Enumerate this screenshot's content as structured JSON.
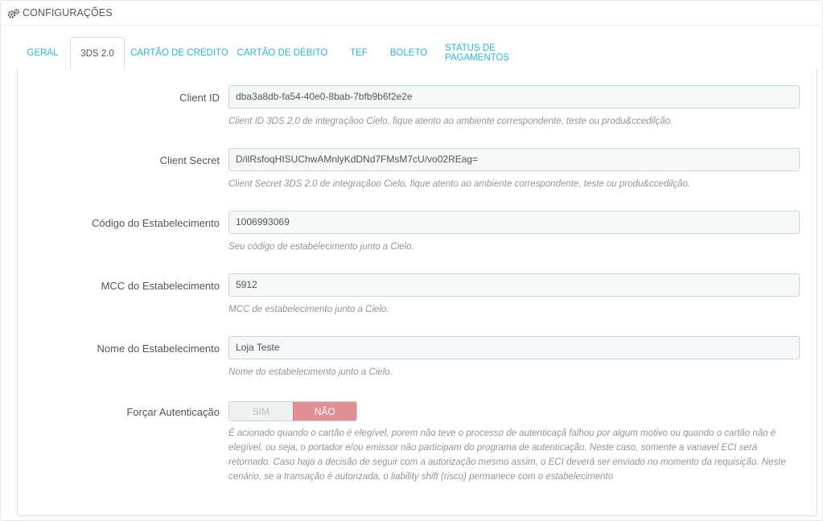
{
  "panel": {
    "title": "CONFIGURAÇÕES",
    "icon": "gears-icon"
  },
  "tabs": [
    {
      "label": "GERAL",
      "active": false
    },
    {
      "label": "3DS 2.0",
      "active": true
    },
    {
      "label": "CARTÃO DE CRÉDITO",
      "active": false
    },
    {
      "label": "CARTÃO DE DÉBITO",
      "active": false
    },
    {
      "label": "TEF",
      "active": false
    },
    {
      "label": "BOLETO",
      "active": false
    },
    {
      "label": "STATUS DE PAGAMENTOS",
      "active": false
    }
  ],
  "fields": {
    "client_id": {
      "label": "Client ID",
      "value": "dba3a8db-fa54-40e0-8bab-7bfb9b6f2e2e",
      "help": "Client ID 3DS 2.0 de integraçãoo Cielo, fique atento ao ambiente correspondente, teste ou produ&ccedilção."
    },
    "client_secret": {
      "label": "Client Secret",
      "value": "D/ilRsfoqHISUChwAMnlyKdDNd7FMsM7cU/vo02REag=",
      "help": "Client Secret 3DS 2.0 de integraçãoo Cielo, fique atento ao ambiente correspondente, teste ou produ&ccedilção."
    },
    "codigo": {
      "label": "Código do Estabelecimento",
      "value": "1006993069",
      "help": "Seu código de estabelecimento junto a Cielo."
    },
    "mcc": {
      "label": "MCC do Estabelecimento",
      "value": "5912",
      "help": "MCC de estabelecimento junto a Cielo."
    },
    "nome": {
      "label": "Nome do Estabelecimento",
      "value": "Loja Teste",
      "help": "Nome do estabelecimento junto a Cielo."
    },
    "forcar": {
      "label": "Forçar Autenticação",
      "option_yes": "SIM",
      "option_no": "NÃO",
      "selected": "NÃO",
      "help": "É acionado quando o cartão é elegível, porem não teve o processo de autenticaçã falhou por algum motivo ou quando o cartão não é elegível, ou seja, o portador e/ou emissor não participam do programa de autenticação. Neste caso, somente a variavel ECI será retornado. Caso haja a decisão de seguir com a autorização mesmo assim, o ECI deverá ser enviado no momento da requisição. Neste cenário, se a transação é autorizada, o liability shift (risco) permanece com o estabelecimento"
    }
  },
  "colors": {
    "tab_link": "#25b9d7",
    "switch_no_active": "#e08f95",
    "input_bg": "#f5f8f9"
  }
}
